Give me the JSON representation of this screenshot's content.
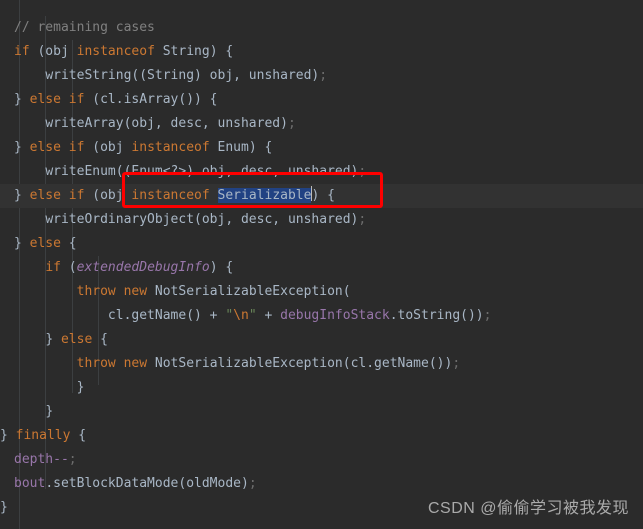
{
  "editor": {
    "theme_name": "darcula",
    "background_color": "#2b2b2b",
    "caret_line_color": "#323232",
    "selection_color": "#214283",
    "annotation_color": "#fe0000",
    "default_text_color": "#a9b7c6",
    "keyword_color": "#cc7832",
    "comment_color": "#808080",
    "field_color": "#9876aa",
    "string_color": "#6a8759",
    "lines": [
      {
        "id": "line-1",
        "text": "    // remaining cases"
      },
      {
        "id": "line-2",
        "text": "    if (obj instanceof String) {"
      },
      {
        "id": "line-3",
        "text": "        writeString((String) obj, unshared);"
      },
      {
        "id": "line-4",
        "text": "    } else if (cl.isArray()) {"
      },
      {
        "id": "line-5",
        "text": "        writeArray(obj, desc, unshared);"
      },
      {
        "id": "line-6",
        "text": "    } else if (obj instanceof Enum) {"
      },
      {
        "id": "line-7",
        "text": "        writeEnum((Enum<?>) obj, desc, unshared);"
      },
      {
        "id": "line-8",
        "text": "    } else if (obj instanceof Serializable) {"
      },
      {
        "id": "line-9",
        "text": "        writeOrdinaryObject(obj, desc, unshared);"
      },
      {
        "id": "line-10",
        "text": "    } else {"
      },
      {
        "id": "line-11",
        "text": "        if (extendedDebugInfo) {"
      },
      {
        "id": "line-12",
        "text": "            throw new NotSerializableException("
      },
      {
        "id": "line-13",
        "text": "                cl.getName() + \"\\n\" + debugInfoStack.toString());"
      },
      {
        "id": "line-14",
        "text": "        } else {"
      },
      {
        "id": "line-15",
        "text": "            throw new NotSerializableException(cl.getName());"
      },
      {
        "id": "line-16",
        "text": "        }"
      },
      {
        "id": "line-17",
        "text": "    }"
      },
      {
        "id": "line-18",
        "text": "} finally {"
      },
      {
        "id": "line-19",
        "text": "    depth--;"
      },
      {
        "id": "line-20",
        "text": "    bout.setBlockDataMode(oldMode);"
      },
      {
        "id": "line-21",
        "text": "}"
      }
    ],
    "selection": {
      "line_id": "line-8",
      "selected_text": "Serializable"
    },
    "annotation": {
      "shape": "rectangle",
      "target_text": "(obj instanceof Serializable) {"
    }
  },
  "tokens": {
    "l1": {
      "comment": "// remaining cases"
    },
    "l2": {
      "kw_if": "if",
      "open": " (obj ",
      "kw_instanceof": "instanceof",
      "type": " String) {"
    },
    "l3": {
      "call": "writeString((String) obj, unshared)",
      "semi": ";"
    },
    "l4": {
      "brace": "} ",
      "kw_else": "else",
      "kw_if": "if",
      "rest": " (cl.isArray()) {"
    },
    "l5": {
      "call": "writeArray(obj, desc, unshared)",
      "semi": ";"
    },
    "l6": {
      "brace": "} ",
      "kw_else": "else",
      "kw_if": "if",
      "mid": " (obj ",
      "kw_instanceof": "instanceof",
      "type": " Enum) {"
    },
    "l7": {
      "call": "writeEnum((Enum<?>) obj, desc, unshared)",
      "semi": ";"
    },
    "l8": {
      "brace": "} ",
      "kw_else": "else",
      "kw_if": "if",
      "mid": " (obj ",
      "kw_instanceof": "instanceof",
      "sel": "Serializable",
      "tail": ") {"
    },
    "l9": {
      "call": "writeOrdinaryObject(obj, desc, unshared)",
      "semi": ";"
    },
    "l10": {
      "brace": "} ",
      "kw_else": "else",
      "tail": " {"
    },
    "l11": {
      "kw_if": "if",
      "open": " (",
      "field": "extendedDebugInfo",
      "tail": ") {"
    },
    "l12": {
      "kw_throw": "throw",
      "kw_new": "new",
      "type": " NotSerializableException("
    },
    "l13": {
      "call": "cl.getName() + ",
      "quote1": "\"",
      "esc": "\\n",
      "quote2": "\"",
      "plus": " + ",
      "field": "debugInfoStack",
      "tail": ".toString())",
      "semi": ";"
    },
    "l14": {
      "brace": "} ",
      "kw_else": "else",
      "tail": " {"
    },
    "l15": {
      "kw_throw": "throw",
      "kw_new": "new",
      "type": " NotSerializableException(cl.getName())",
      "semi": ";"
    },
    "l16": {
      "brace": "}"
    },
    "l17": {
      "brace": "}"
    },
    "l18": {
      "brace": "} ",
      "kw_finally": "finally",
      "tail": " {"
    },
    "l19": {
      "field": "depth",
      "op": "--",
      "semi": ";"
    },
    "l20": {
      "field": "bout",
      "call": ".setBlockDataMode(oldMode)",
      "semi": ";"
    },
    "l21": {
      "brace": "}"
    }
  },
  "watermark": {
    "text": "CSDN @偷偷学习被我发现"
  }
}
